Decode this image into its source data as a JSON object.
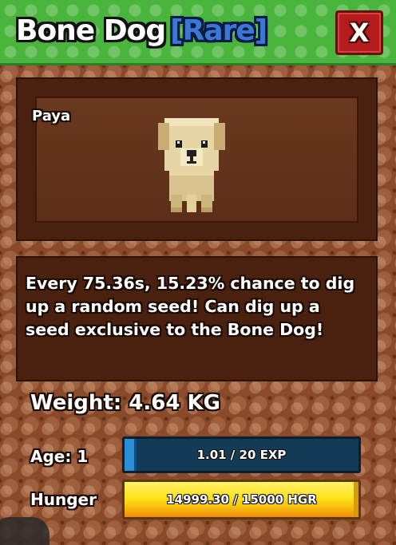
{
  "header": {
    "pet_name": "Bone Dog",
    "rarity": "[Rare]",
    "close_label": "X"
  },
  "preview": {
    "owner_name": "Paya"
  },
  "description": {
    "line1": "Every 75.36s, 15.23% chance to dig",
    "line2": "up a random seed! Can dig up a",
    "line3": "seed exclusive to the Bone Dog!"
  },
  "stats": {
    "weight_text": "Weight: 4.64 KG",
    "age_text": "Age: 1",
    "hunger_label": "Hunger",
    "exp_text": "1.01 / 20 EXP",
    "exp_fraction": 0.05,
    "hunger_text": "14999.30 / 15000 HGR",
    "hunger_fraction": 0.99995
  },
  "colors": {
    "header_green": "#49b53c",
    "rarity_blue": "#3a78d8",
    "close_red": "#b51d1d",
    "exp_blue": "#2c8ed6",
    "hunger_yellow": "#ffe21a"
  }
}
